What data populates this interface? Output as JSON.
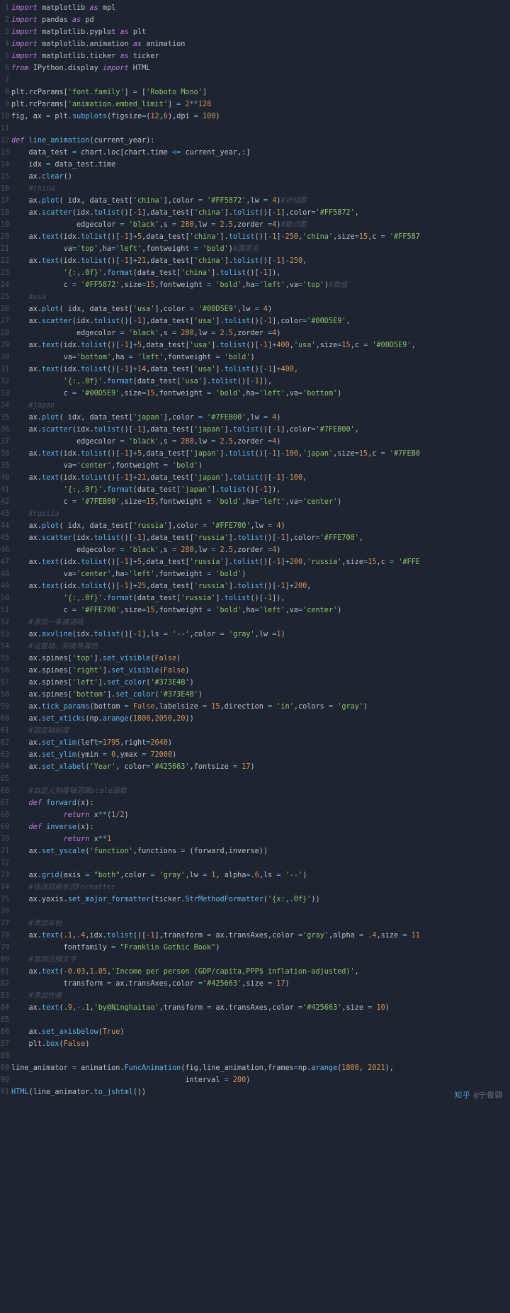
{
  "watermark": {
    "logo_text": "知乎",
    "user": "@宁俊骐",
    "alt": "知乎Daad宁俊骐"
  },
  "code": {
    "lines": [
      "import matplotlib as mpl",
      "import pandas as pd",
      "import matplotlib.pyplot as plt",
      "import matplotlib.animation as animation",
      "import matplotlib.ticker as ticker",
      "from IPython.display import HTML",
      "",
      "plt.rcParams['font.family'] = ['Roboto Mono']",
      "plt.rcParams['animation.embed_limit'] = 2**128",
      "fig, ax = plt.subplots(figsize=(12,6),dpi = 100)",
      "",
      "def line_animation(current_year):",
      "    data_test = chart.loc[chart.time <= current_year,:]",
      "    idx = data_test.time",
      "    ax.clear()",
      "    #china",
      "    ax.plot( idx, data_test['china'],color = '#FF5872',lw = 4)#折线图",
      "    ax.scatter(idx.tolist()[-1],data_test['china'].tolist()[-1],color='#FF5872',",
      "               edgecolor = 'black',s = 280,lw = 2.5,zorder =4)#散点图",
      "    ax.text(idx.tolist()[-1]+5,data_test['china'].tolist()[-1]-250,'china',size=15,c = '#FF587",
      "            va='top',ha='left',fontweight = 'bold')#国家名",
      "    ax.text(idx.tolist()[-1]+21,data_test['china'].tolist()[-1]-250,",
      "            '{:,.0f}'.format(data_test['china'].tolist()[-1]),",
      "            c = '#FF5872',size=15,fontweight = 'bold',ha='left',va='top')#数值",
      "    #usa",
      "    ax.plot( idx, data_test['usa'],color = '#00D5E9',lw = 4)",
      "    ax.scatter(idx.tolist()[-1],data_test['usa'].tolist()[-1],color='#00D5E9',",
      "               edgecolor = 'black',s = 280,lw = 2.5,zorder =4)",
      "    ax.text(idx.tolist()[-1]+5,data_test['usa'].tolist()[-1]+400,'usa',size=15,c = '#00D5E9',",
      "            va='bottom',ha = 'left',fontweight = 'bold')",
      "    ax.text(idx.tolist()[-1]+14,data_test['usa'].tolist()[-1]+400,",
      "            '{:,.0f}'.format(data_test['usa'].tolist()[-1]),",
      "            c = '#00D5E9',size=15,fontweight = 'bold',ha='left',va='bottom')",
      "    #japan",
      "    ax.plot( idx, data_test['japan'],color = '#7FEB00',lw = 4)",
      "    ax.scatter(idx.tolist()[-1],data_test['japan'].tolist()[-1],color='#7FEB00',",
      "               edgecolor = 'black',s = 280,lw = 2.5,zorder =4)",
      "    ax.text(idx.tolist()[-1]+5,data_test['japan'].tolist()[-1]-100,'japan',size=15,c = '#7FEB0",
      "            va='center',fontweight = 'bold')",
      "    ax.text(idx.tolist()[-1]+21,data_test['japan'].tolist()[-1]-100,",
      "            '{:,.0f}'.format(data_test['japan'].tolist()[-1]),",
      "            c = '#7FEB00',size=15,fontweight = 'bold',ha='left',va='center')",
      "    #russia",
      "    ax.plot( idx, data_test['russia'],color = '#FFE700',lw = 4)",
      "    ax.scatter(idx.tolist()[-1],data_test['russia'].tolist()[-1],color='#FFE700',",
      "               edgecolor = 'black',s = 280,lw = 2.5,zorder =4)",
      "    ax.text(idx.tolist()[-1]+5,data_test['russia'].tolist()[-1]+200,'russia',size=15,c = '#FFE",
      "            va='center',ha='left',fontweight = 'bold')",
      "    ax.text(idx.tolist()[-1]+25,data_test['russia'].tolist()[-1]+200,",
      "            '{:,.0f}'.format(data_test['russia'].tolist()[-1]),",
      "            c = '#FFE700',size=15,fontweight = 'bold',ha='left',va='center')",
      "    #添加一条推进线",
      "    ax.axvline(idx.tolist()[-1],ls = '--',color = 'gray',lw =1)",
      "    #设置轴、刻度等属性",
      "    ax.spines['top'].set_visible(False)",
      "    ax.spines['right'].set_visible(False)",
      "    ax.spines['left'].set_color('#373E4B')",
      "    ax.spines['bottom'].set_color('#373E4B')",
      "    ax.tick_params(bottom = False,labelsize = 15,direction = 'in',colors = 'gray')",
      "    ax.set_xticks(np.arange(1800,2050,20))",
      "    #固定轴刻度",
      "    ax.set_xlim(left=1795,right=2040)",
      "    ax.set_ylim(ymin = 0,ymax = 72000)",
      "    ax.set_xlabel('Year', color='#425663',fontsize = 17)",
      "",
      "    #自定义刻度轴范围scale函数",
      "    def forward(x):",
      "            return x**(1/2)",
      "    def inverse(x):",
      "            return x**1",
      "    ax.set_yscale('function',functions = (forward,inverse))",
      "",
      "    ax.grid(axis = \"both\",color = 'gray',lw = 1, alpha=.6,ls = '--')",
      "    #修改刻度系式Formatter",
      "    ax.yaxis.set_major_formatter(ticker.StrMethodFormatter('{x:,.0f}'))",
      "",
      "    #添加年份",
      "    ax.text(.1,.4,idx.tolist()[-1],transform = ax.transAxes,color ='gray',alpha = .4,size = 11",
      "            fontfamily = \"Franklin Gothic Book\")",
      "    #添加注释文字",
      "    ax.text(-0.03,1.05,'Income per person (GDP/capita,PPP$ inflation-adjusted)',",
      "            transform = ax.transAxes,color ='#425663',size = 17)",
      "    #添加作者",
      "    ax.text(.9,-.1,'by@Ninghaitao',transform = ax.transAxes,color ='#425663',size = 10)",
      "",
      "    ax.set_axisbelow(True)",
      "    plt.box(False)",
      "",
      "line_animator = animation.FuncAnimation(fig,line_animation,frames=np.arange(1800, 2021),",
      "                                        interval = 200)",
      "HTML(line_animator.to_jshtml())"
    ]
  }
}
